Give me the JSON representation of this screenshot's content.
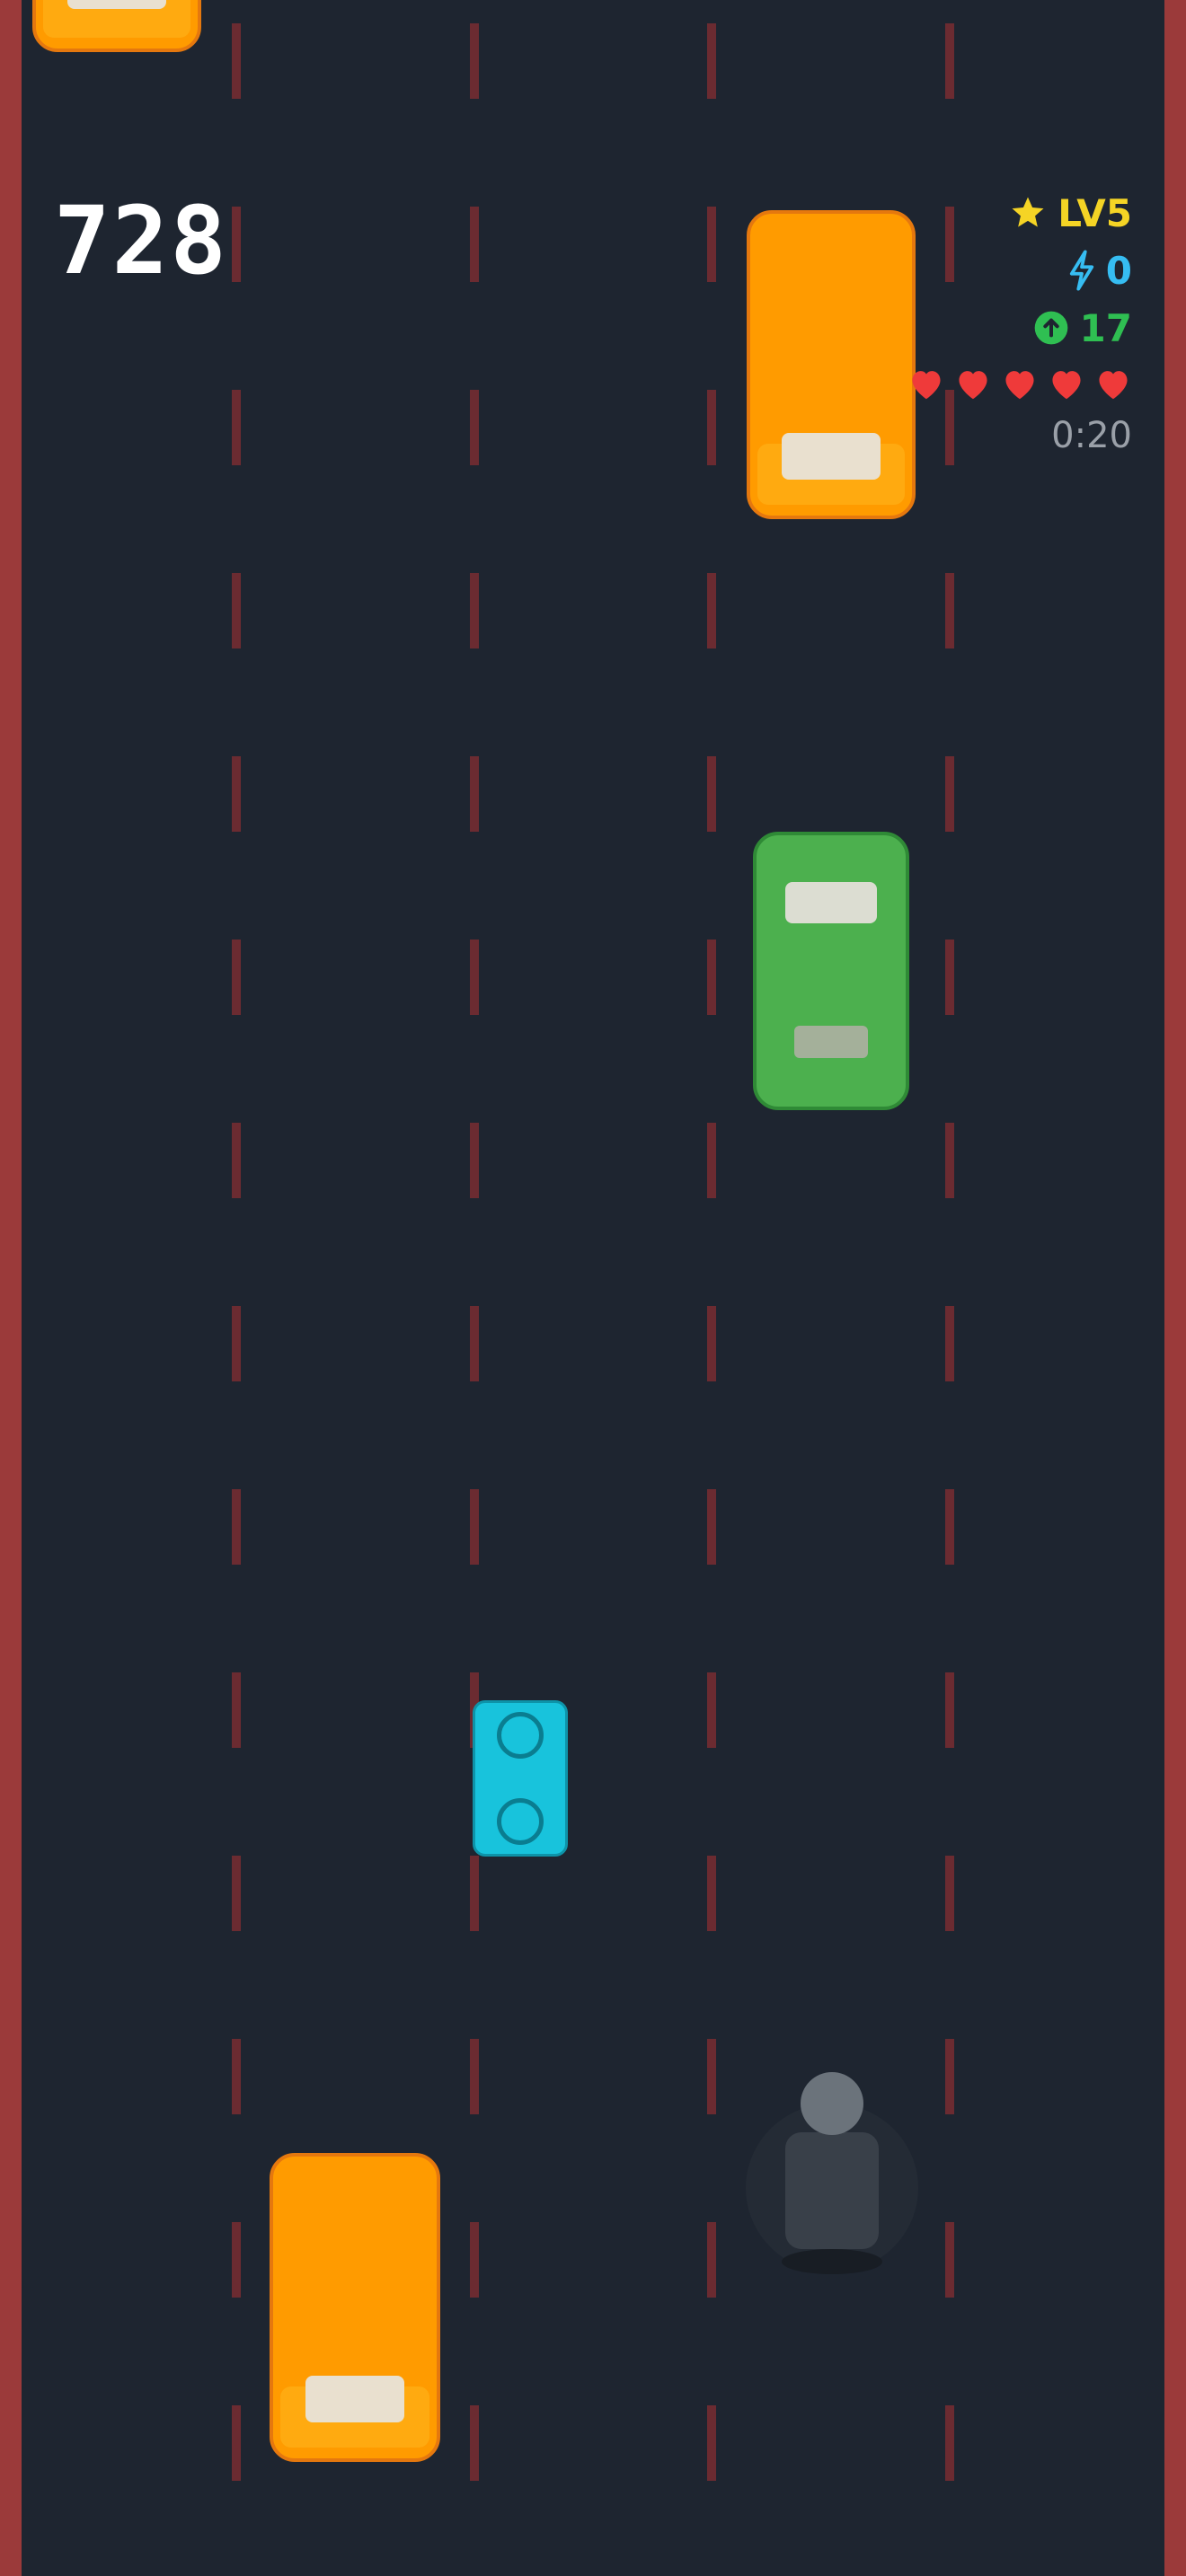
{
  "game": {
    "score": "728",
    "level": "LV5",
    "boost_count": "0",
    "coin_count": "17",
    "lives": 5,
    "lives_max": 5,
    "timer": "0:20"
  },
  "icons": {
    "level": "star-icon",
    "boost": "lightning-icon",
    "coins": "coin-arrow-icon",
    "lives": "heart-icon"
  },
  "colors": {
    "road": "#1e2530",
    "edge": "#9b3a3a",
    "lane_dash": "#6b2b31",
    "level": "#f5d425",
    "boost": "#36bdf2",
    "coins": "#2fbf52",
    "heart": "#ef3a3a",
    "timer": "#9aa0a8",
    "van": "#ff9b00",
    "green_car": "#4cb04e",
    "bike": "#18c3dc",
    "player": "#394049"
  },
  "vehicles": [
    {
      "type": "orange-van",
      "lane": 1
    },
    {
      "type": "orange-van",
      "lane": 4
    },
    {
      "type": "green-car",
      "lane": 4
    },
    {
      "type": "cyan-motorbike",
      "lane": 2
    },
    {
      "type": "orange-van",
      "lane": 2
    },
    {
      "type": "player-car",
      "lane": 4
    }
  ]
}
